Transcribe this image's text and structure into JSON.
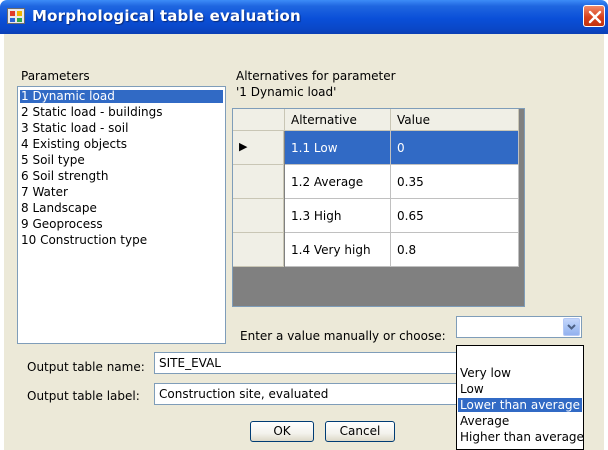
{
  "window": {
    "title": "Morphological table evaluation"
  },
  "parameters": {
    "label": "Parameters",
    "items": [
      "1 Dynamic load",
      "2 Static load - buildings",
      "3 Static load - soil",
      "4 Existing objects",
      "5 Soil type",
      "6 Soil strength",
      "7 Water",
      "8 Landscape",
      "9 Geoprocess",
      "10 Construction type"
    ],
    "selected_index": 0
  },
  "alternatives": {
    "label_line1": "Alternatives for parameter",
    "label_line2": "'1 Dynamic load'",
    "columns": [
      "Alternative",
      "Value"
    ],
    "rows": [
      {
        "alternative": "1.1 Low",
        "value": "0",
        "selected": true
      },
      {
        "alternative": "1.2 Average",
        "value": "0.35",
        "selected": false
      },
      {
        "alternative": "1.3 High",
        "value": "0.65",
        "selected": false
      },
      {
        "alternative": "1.4 Very high",
        "value": "0.8",
        "selected": false
      }
    ],
    "current_row_marker": "▶"
  },
  "manual_value": {
    "label": "Enter a value manually or choose:",
    "value": "",
    "options": [
      "Very low",
      "Low",
      "Lower than average",
      "Average",
      "Higher than average"
    ],
    "highlighted_index": 2
  },
  "output": {
    "name_label": "Output table name:",
    "name_value": "SITE_EVAL",
    "table_label_label": "Output table label:",
    "table_label_value": "Construction site, evaluated"
  },
  "buttons": {
    "ok": "OK",
    "cancel": "Cancel"
  },
  "colors": {
    "title_bar": "#0a4fd8",
    "selection": "#316ac5",
    "dialog_bg": "#ece9d8",
    "grid_bg": "#808080",
    "close_button": "#d9421d"
  }
}
